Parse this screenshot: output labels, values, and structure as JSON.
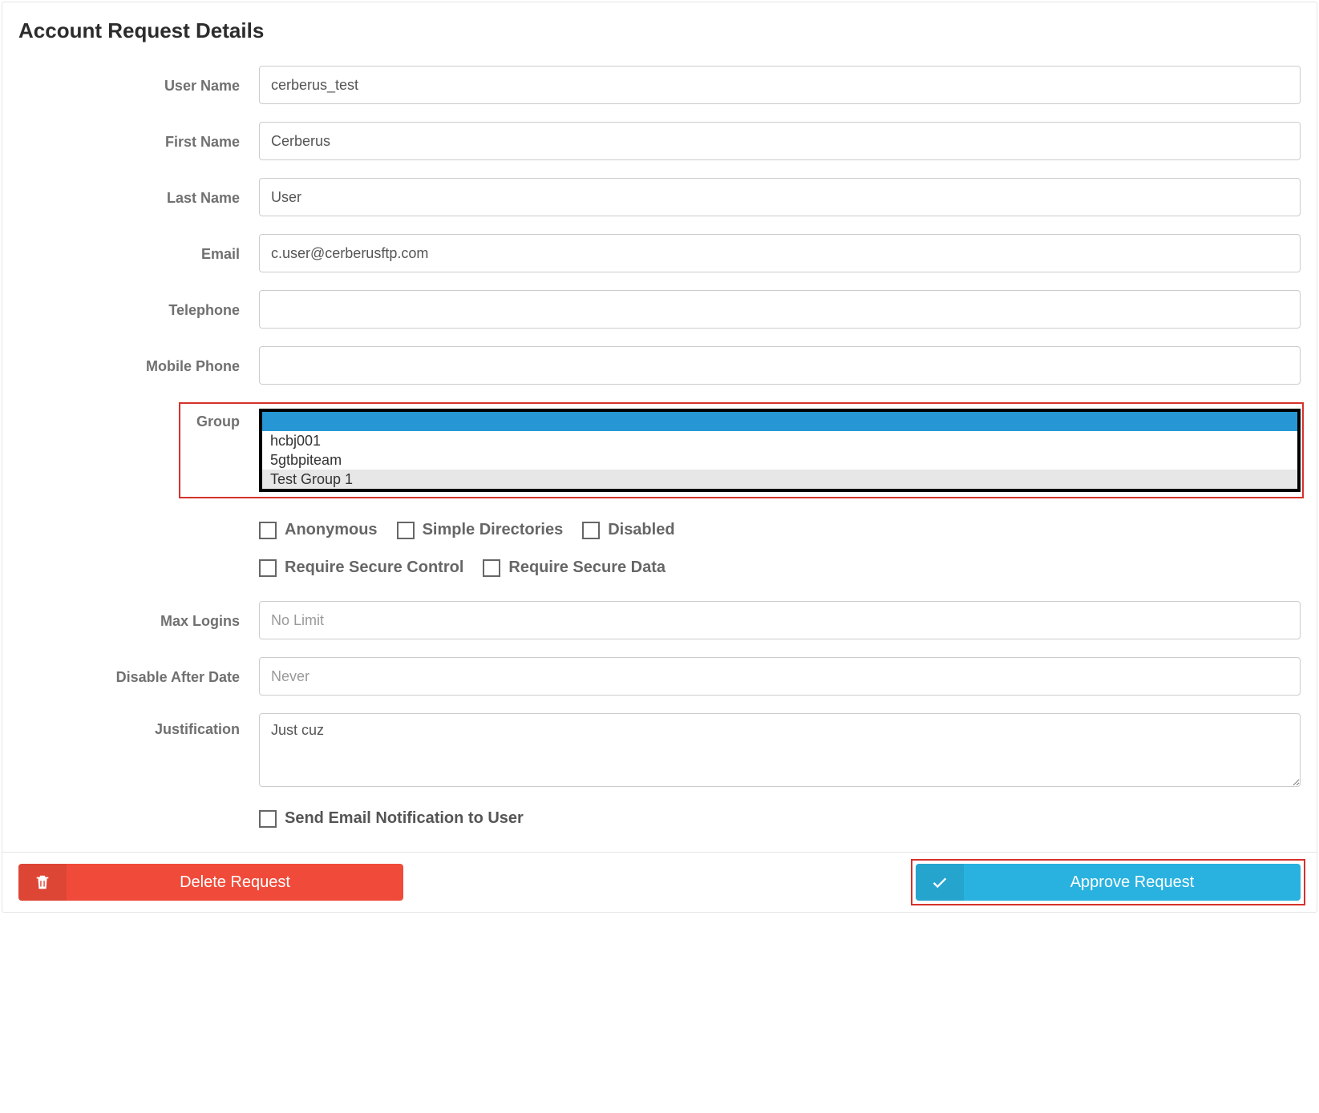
{
  "header": {
    "title": "Account Request Details"
  },
  "labels": {
    "user_name": "User Name",
    "first_name": "First Name",
    "last_name": "Last Name",
    "email": "Email",
    "telephone": "Telephone",
    "mobile_phone": "Mobile Phone",
    "group": "Group",
    "max_logins": "Max Logins",
    "disable_after_date": "Disable After Date",
    "justification": "Justification"
  },
  "values": {
    "user_name": "cerberus_test",
    "first_name": "Cerberus",
    "last_name": "User",
    "email": "c.user@cerberusftp.com",
    "telephone": "",
    "mobile_phone": "",
    "max_logins": "",
    "disable_after_date": "",
    "justification": "Just cuz"
  },
  "placeholders": {
    "max_logins": "No Limit",
    "disable_after_date": "Never"
  },
  "group_listbox": {
    "items": [
      "",
      "hcbj001",
      "5gtbpiteam",
      "Test Group 1"
    ],
    "selected_index": 0
  },
  "checkboxes_row1": [
    {
      "label": "Anonymous",
      "checked": false
    },
    {
      "label": "Simple Directories",
      "checked": false
    },
    {
      "label": "Disabled",
      "checked": false
    }
  ],
  "checkboxes_row2": [
    {
      "label": "Require Secure Control",
      "checked": false
    },
    {
      "label": "Require Secure Data",
      "checked": false
    }
  ],
  "notify": {
    "label": "Send Email Notification to User",
    "checked": false
  },
  "footer": {
    "delete_label": "Delete Request",
    "approve_label": "Approve Request"
  }
}
